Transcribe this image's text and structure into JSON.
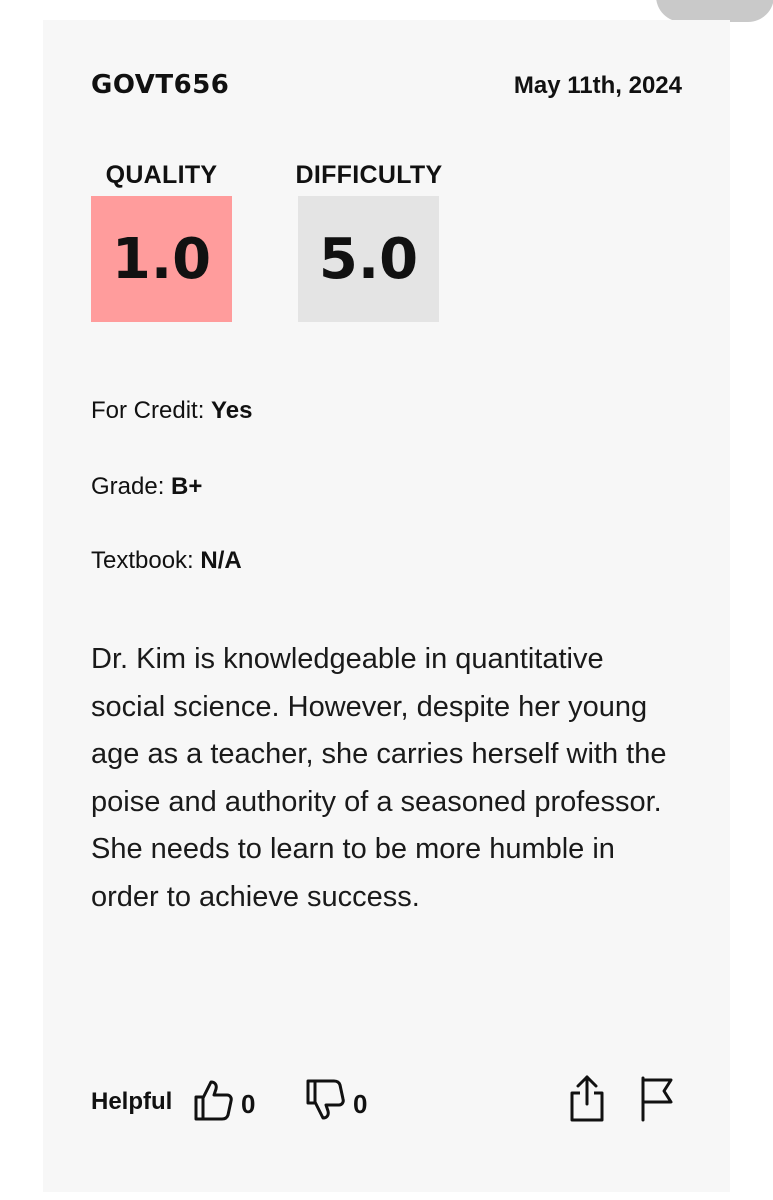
{
  "review": {
    "course": "GOVT656",
    "date": "May 11th, 2024",
    "quality": {
      "label": "QUALITY",
      "value": "1.0",
      "color": "#ff9c9c"
    },
    "difficulty": {
      "label": "DIFFICULTY",
      "value": "5.0",
      "color": "#e4e4e4"
    },
    "meta": {
      "for_credit_label": "For Credit:",
      "for_credit_value": "Yes",
      "grade_label": "Grade:",
      "grade_value": "B+",
      "textbook_label": "Textbook:",
      "textbook_value": "N/A"
    },
    "comment": "Dr. Kim is knowledgeable in quantitative social science. However, despite her young age as a teacher, she carries herself with the poise and authority of a seasoned professor. She needs to learn to be more humble in order to achieve success."
  },
  "footer": {
    "helpful_label": "Helpful",
    "thumbs_up_count": "0",
    "thumbs_down_count": "0",
    "icons": [
      "thumbs-up-icon",
      "thumbs-down-icon",
      "share-icon",
      "flag-icon"
    ]
  }
}
